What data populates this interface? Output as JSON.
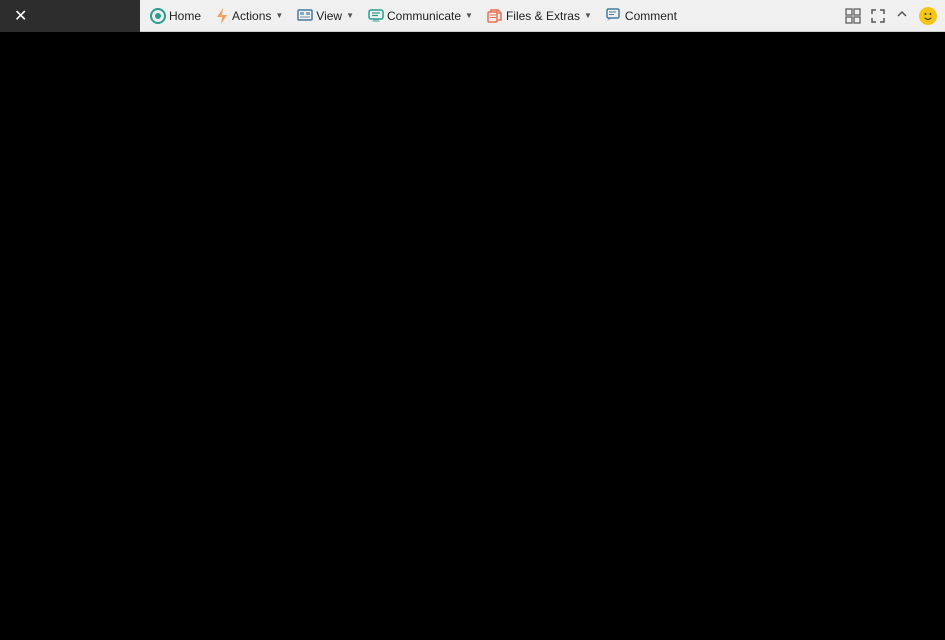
{
  "toolbar": {
    "close_label": "✕",
    "buttons": [
      {
        "id": "home",
        "label": "Home",
        "icon": "home-icon",
        "has_dropdown": false
      },
      {
        "id": "actions",
        "label": "Actions",
        "icon": "bolt-icon",
        "has_dropdown": true
      },
      {
        "id": "view",
        "label": "View",
        "icon": "view-icon",
        "has_dropdown": true
      },
      {
        "id": "communicate",
        "label": "Communicate",
        "icon": "comm-icon",
        "has_dropdown": true
      },
      {
        "id": "files-extras",
        "label": "Files & Extras",
        "icon": "files-icon",
        "has_dropdown": true
      },
      {
        "id": "comment",
        "label": "Comment",
        "icon": "comment-icon",
        "has_dropdown": false
      }
    ]
  },
  "main_content": {
    "background": "#000000"
  }
}
